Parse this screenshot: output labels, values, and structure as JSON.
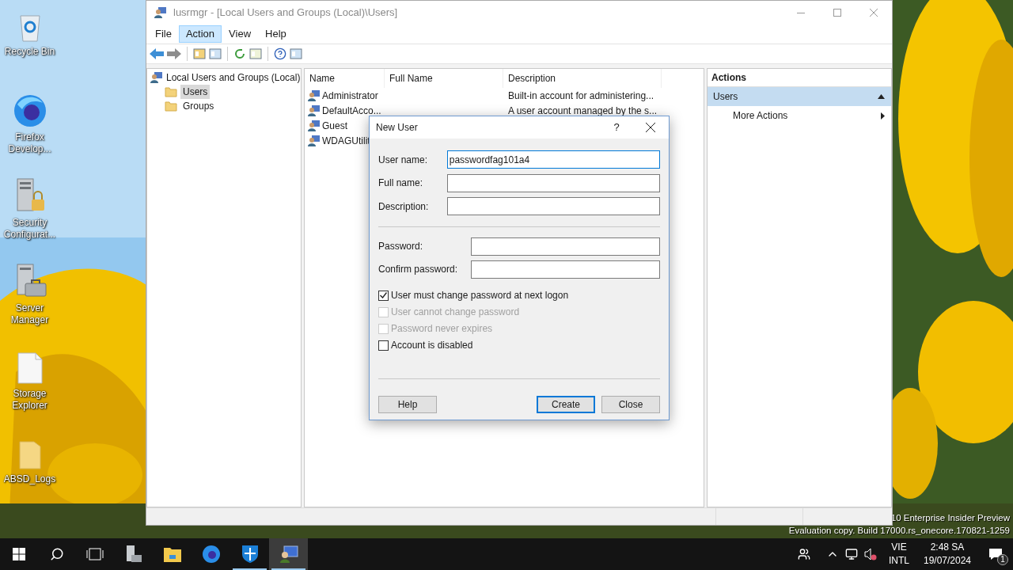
{
  "desktop_icons": [
    {
      "label": "Recycle Bin",
      "kind": "bin"
    },
    {
      "label": "Firefox Develop...",
      "kind": "orb"
    },
    {
      "label": "Security Configurat...",
      "kind": "lock-server"
    },
    {
      "label": "Server Manager",
      "kind": "server"
    },
    {
      "label": "Storage Explorer",
      "kind": "file"
    },
    {
      "label": "ABSD_Logs",
      "kind": "folder"
    }
  ],
  "window": {
    "title": "lusrmgr - [Local Users and Groups (Local)\\Users]",
    "menu": [
      {
        "label": "File",
        "selected": false
      },
      {
        "label": "Action",
        "selected": true
      },
      {
        "label": "View",
        "selected": false
      },
      {
        "label": "Help",
        "selected": false
      }
    ],
    "tree": {
      "label": "Local Users and Groups (Local)",
      "children": [
        {
          "label": "Users",
          "selected": true
        },
        {
          "label": "Groups",
          "selected": false
        }
      ]
    },
    "list": {
      "columns": [
        "Name",
        "Full Name",
        "Description"
      ],
      "rows": [
        {
          "name": "Administrator",
          "description": "Built-in account for administering..."
        },
        {
          "name": "DefaultAcco...",
          "description": "A user account managed by the s..."
        },
        {
          "name": "Guest"
        },
        {
          "name": "WDAGUtilit"
        }
      ]
    },
    "actions": {
      "title": "Actions",
      "section": {
        "label": "Users",
        "expanded": true
      },
      "items": [
        "More Actions"
      ]
    }
  },
  "dialog": {
    "title": "New User",
    "help": "?",
    "account_fields": [
      {
        "label": "User name:",
        "value": "passwordfag101a4",
        "focused": true
      },
      {
        "label": "Full name:",
        "focused": false
      },
      {
        "label": "Description:",
        "focused": false
      }
    ],
    "password_fields": [
      {
        "label": "Password:",
        "focused": false
      },
      {
        "label": "Confirm password:",
        "focused": false
      }
    ],
    "options": [
      {
        "label": "User must change password at next logon",
        "checked": true,
        "disabled": false
      },
      {
        "label": "User cannot change password",
        "checked": false,
        "disabled": true
      },
      {
        "label": "Password never expires",
        "checked": false,
        "disabled": true
      },
      {
        "label": "Account is disabled",
        "checked": false,
        "disabled": false
      }
    ],
    "left_buttons": [
      {
        "label": "Help",
        "default": false
      }
    ],
    "right_buttons": [
      {
        "label": "Create",
        "default": true
      },
      {
        "label": "Close",
        "default": false
      }
    ]
  },
  "notice": [
    "10 Enterprise Insider Preview",
    "Evaluation copy. Build 17000.rs_onecore.170821-1259"
  ],
  "taskbar": {
    "apps": [
      {
        "kind": "server",
        "selected": false,
        "running": false
      },
      {
        "kind": "folder",
        "selected": false,
        "running": false
      },
      {
        "kind": "orb",
        "selected": false,
        "running": false
      },
      {
        "kind": "shield",
        "selected": false,
        "running": true
      },
      {
        "kind": "users",
        "selected": true,
        "running": true
      }
    ],
    "language": [
      "VIE",
      "INTL"
    ],
    "time": "2:48 SA",
    "date": "19/07/2024",
    "notifications": "1"
  }
}
